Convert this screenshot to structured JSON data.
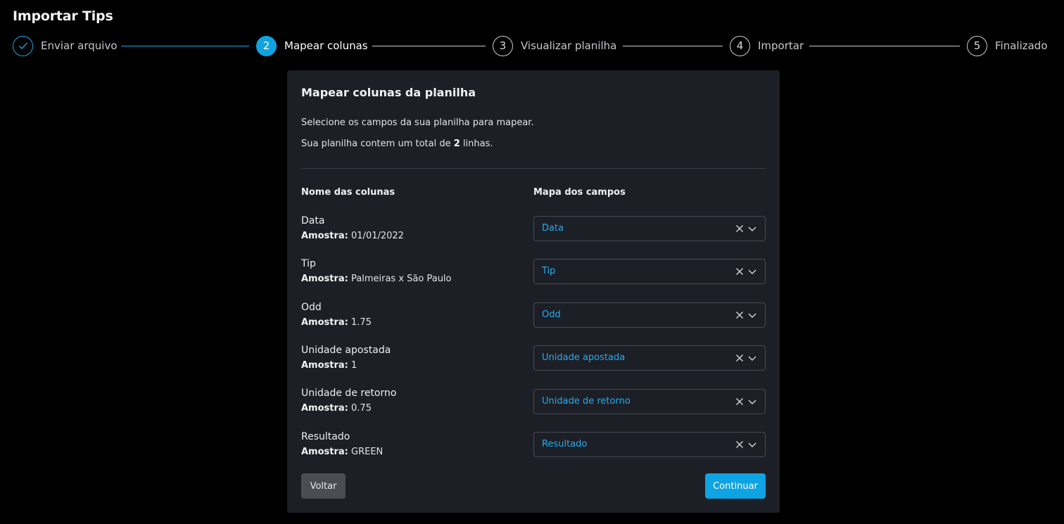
{
  "page": {
    "title": "Importar Tips"
  },
  "stepper": {
    "steps": [
      {
        "number": "1",
        "label": "Enviar arquivo",
        "status": "done"
      },
      {
        "number": "2",
        "label": "Mapear colunas",
        "status": "active"
      },
      {
        "number": "3",
        "label": "Visualizar planilha",
        "status": "pending"
      },
      {
        "number": "4",
        "label": "Importar",
        "status": "pending"
      },
      {
        "number": "5",
        "label": "Finalizado",
        "status": "pending"
      }
    ]
  },
  "card": {
    "title": "Mapear colunas da planilha",
    "description": "Selecione os campos da sua planilha para mapear.",
    "total_prefix": "Sua planilha contem um total de",
    "total_count": "2",
    "total_suffix": "linhas.",
    "col_header_left": "Nome das colunas",
    "col_header_right": "Mapa dos campos",
    "sample_label": "Amostra:",
    "rows": [
      {
        "name": "Data",
        "sample": "01/01/2022",
        "mapped": "Data"
      },
      {
        "name": "Tip",
        "sample": "Palmeiras x São Paulo",
        "mapped": "Tip"
      },
      {
        "name": "Odd",
        "sample": "1.75",
        "mapped": "Odd"
      },
      {
        "name": "Unidade apostada",
        "sample": "1",
        "mapped": "Unidade apostada"
      },
      {
        "name": "Unidade de retorno",
        "sample": "0.75",
        "mapped": "Unidade de retorno"
      },
      {
        "name": "Resultado",
        "sample": "GREEN",
        "mapped": "Resultado"
      }
    ],
    "back_label": "Voltar",
    "continue_label": "Continuar"
  },
  "colors": {
    "background": "#000000",
    "card": "#1c1f26",
    "accent": "#12a2e0",
    "select_text": "#24acf0"
  },
  "icons": {
    "done_step": "check-icon",
    "clear": "close-icon",
    "dropdown": "chevron-down-icon"
  }
}
